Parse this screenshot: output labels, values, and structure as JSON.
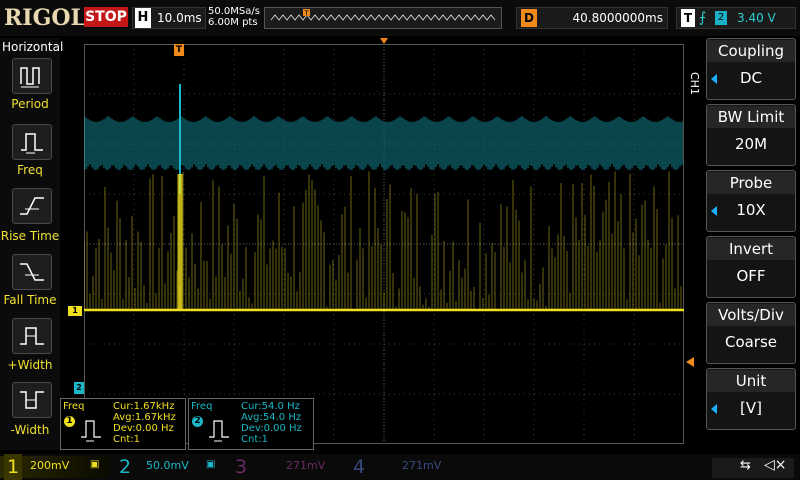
{
  "header": {
    "logo": "RIGOL",
    "run_status": "STOP",
    "horizontal_key": "H",
    "timebase": "10.0ms",
    "sample_rate": "50.0MSa/s",
    "memory_depth": "6.00M pts",
    "delay_key": "D",
    "delay_value": "40.8000000ms",
    "trigger_key": "T",
    "trigger_source": "2",
    "trigger_level": "3.40 V"
  },
  "left_panel": {
    "title": "Horizontal",
    "buttons": [
      {
        "label": "Period",
        "icon": "period-icon"
      },
      {
        "label": "Freq",
        "icon": "frequency-icon"
      },
      {
        "label": "Rise Time",
        "icon": "rise-time-icon"
      },
      {
        "label": "Fall Time",
        "icon": "fall-time-icon"
      },
      {
        "label": "+Width",
        "icon": "positive-width-icon"
      },
      {
        "label": "-Width",
        "icon": "negative-width-icon"
      }
    ]
  },
  "markers": {
    "trigger_pos": "T",
    "ch1_marker": "1",
    "ch2_marker": "2"
  },
  "right_panel": {
    "channel_tag": "CH1",
    "items": [
      {
        "title": "Coupling",
        "value": "DC"
      },
      {
        "title": "BW Limit",
        "value": "20M"
      },
      {
        "title": "Probe",
        "value": "10X"
      },
      {
        "title": "Invert",
        "value": "OFF"
      },
      {
        "title": "Volts/Div",
        "value": "Coarse"
      },
      {
        "title": "Unit",
        "value": "[V]"
      }
    ]
  },
  "measurements": [
    {
      "title": "Freq",
      "channel": "1",
      "cur": "Cur:1.67kHz",
      "avg": "Avg:1.67kHz",
      "dev": "Dev:0.00 Hz",
      "cnt": "Cnt:1"
    },
    {
      "title": "Freq",
      "channel": "2",
      "cur": "Cur:54.0 Hz",
      "avg": "Avg:54.0 Hz",
      "dev": "Dev:0.00 Hz",
      "cnt": "Cnt:1"
    }
  ],
  "bottom": {
    "ch1_num": "1",
    "ch1_scale": "200mV",
    "ch2_num": "2",
    "ch2_scale": "50.0mV",
    "ch3_num": "3",
    "ch3_scale": "271mV",
    "ch4_num": "4",
    "ch4_scale": "271mV"
  },
  "colors": {
    "ch1": "#f0e020",
    "ch2": "#1ab8c8",
    "ch3": "#b03aa0",
    "ch4": "#3a5ab8",
    "trigger": "#f08a1a"
  }
}
